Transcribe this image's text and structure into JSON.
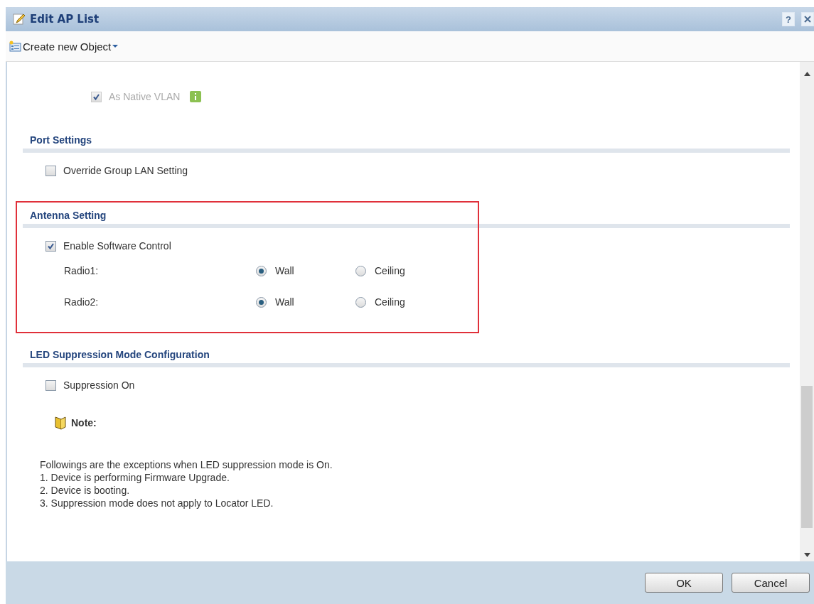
{
  "window": {
    "title": "Edit AP List",
    "help": "?"
  },
  "toolbar": {
    "create_menu": "Create new Object"
  },
  "vlan": {
    "native_vlan": {
      "label": "As Native VLAN",
      "checked": true,
      "disabled": true
    }
  },
  "sections": [
    {
      "title": "Port Settings",
      "highlighted": false,
      "checkboxes": [
        {
          "label": "Override Group LAN Setting",
          "checked": false
        }
      ]
    },
    {
      "title": "Antenna Setting",
      "highlighted": true,
      "checkboxes": [
        {
          "label": "Enable Software Control",
          "checked": true
        }
      ],
      "radios": [
        {
          "label": "Radio1:",
          "options": [
            {
              "label": "Wall",
              "selected": true
            },
            {
              "label": "Ceiling",
              "selected": false
            }
          ]
        },
        {
          "label": "Radio2:",
          "options": [
            {
              "label": "Wall",
              "selected": true
            },
            {
              "label": "Ceiling",
              "selected": false
            }
          ]
        }
      ]
    },
    {
      "title": "LED Suppression Mode Configuration",
      "highlighted": false,
      "checkboxes": [
        {
          "label": "Suppression On",
          "checked": false
        }
      ]
    }
  ],
  "note": {
    "title": "Note:",
    "lines": [
      "Followings are the exceptions when LED suppression mode is On.",
      "1. Device is performing Firmware Upgrade.",
      "2. Device is booting.",
      "3. Suppression mode does not apply to Locator LED."
    ]
  },
  "buttons": [
    "OK",
    "Cancel"
  ]
}
